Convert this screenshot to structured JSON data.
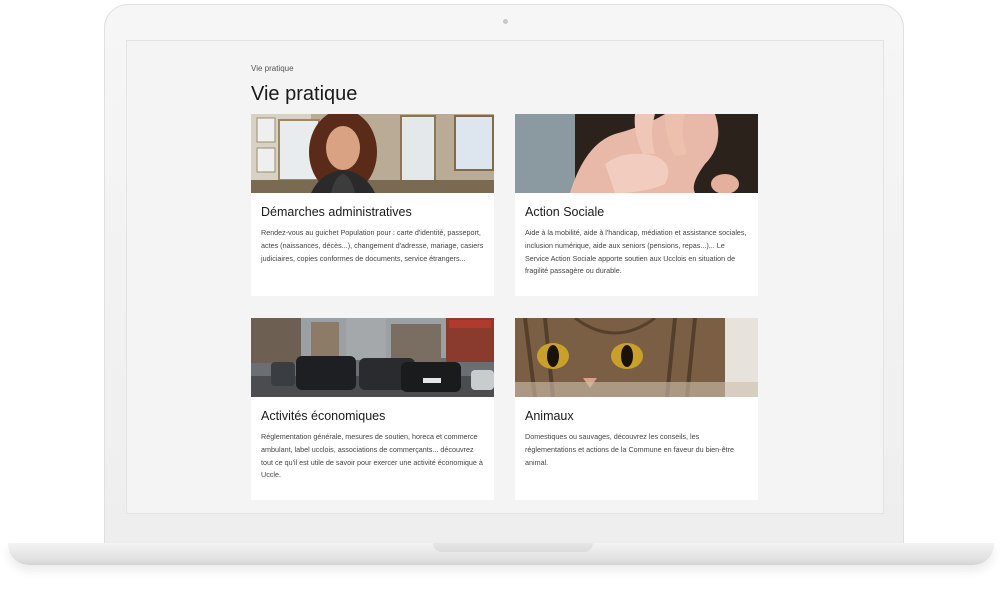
{
  "page": {
    "breadcrumb": "Vie pratique",
    "title": "Vie pratique"
  },
  "cards": [
    {
      "title": "Démarches administratives",
      "text": "Rendez-vous au guichet Population pour : carte d'identité, passeport, actes (naissances, décès...), changement d'adresse, mariage, casiers judiciaires, copies conformes de documents, service étrangers...",
      "image": "woman-at-counter-photo"
    },
    {
      "title": "Action Sociale",
      "text": "Aide à la mobilité, aide à l'handicap, médiation et assistance sociales, inclusion numérique, aide aux seniors (pensions, repas...)... Le Service Action Sociale apporte soutien aux Ucclois en situation de fragilité passagère ou durable.",
      "image": "holding-hands-photo"
    },
    {
      "title": "Activités économiques",
      "text": "Réglementation générale, mesures de soutien, horeca et commerce ambulant, label ucclois, associations de commerçants... découvrez tout ce qu'il est utile de savoir pour exercer une activité économique à Uccle.",
      "image": "shopping-street-photo"
    },
    {
      "title": "Animaux",
      "text": "Domestiques ou sauvages, découvrez les conseils, les réglementations et actions de la Commune en faveur du bien-être animal.",
      "image": "cat-face-photo"
    }
  ]
}
